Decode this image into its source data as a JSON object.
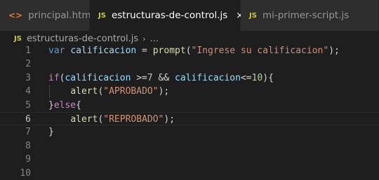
{
  "tabs": [
    {
      "icon": "<>",
      "label": "principal.html",
      "active": false
    },
    {
      "icon": "JS",
      "label": "estructuras-de-control.js",
      "active": true,
      "close": "×"
    },
    {
      "icon": "JS",
      "label": "mi-primer-script.js",
      "active": false
    }
  ],
  "breadcrumb": {
    "icon": "JS",
    "file": "estructuras-de-control.js",
    "separator": "›",
    "more": "..."
  },
  "editor": {
    "line_numbers": [
      "1",
      "2",
      "3",
      "4",
      "5",
      "6",
      "7",
      "8",
      "9",
      "10"
    ],
    "current_line": 6,
    "lines": {
      "l1": {
        "kw": "var",
        "v": "calificacion",
        "op": " = ",
        "fn": "prompt",
        "p1": "(",
        "s": "\"Ingrese su calificacion\"",
        "p2": ");"
      },
      "l3": {
        "kw": "if",
        "p1": "(",
        "v1": "calificacion",
        "op1": " >=",
        "n1": "7",
        "op2": " && ",
        "v2": "calificacion",
        "op3": "<=",
        "n2": "10",
        "p2": "){"
      },
      "l4": {
        "fn": "alert",
        "p1": "(",
        "s": "\"APROBADO\"",
        "p2": ");"
      },
      "l5": {
        "p1": "}",
        "kw": "else",
        "p2": "{"
      },
      "l6": {
        "fn": "alert",
        "p1": "(",
        "s": "\"REPROBADO\"",
        "p2": ");"
      },
      "l7": {
        "p1": "}"
      }
    }
  }
}
